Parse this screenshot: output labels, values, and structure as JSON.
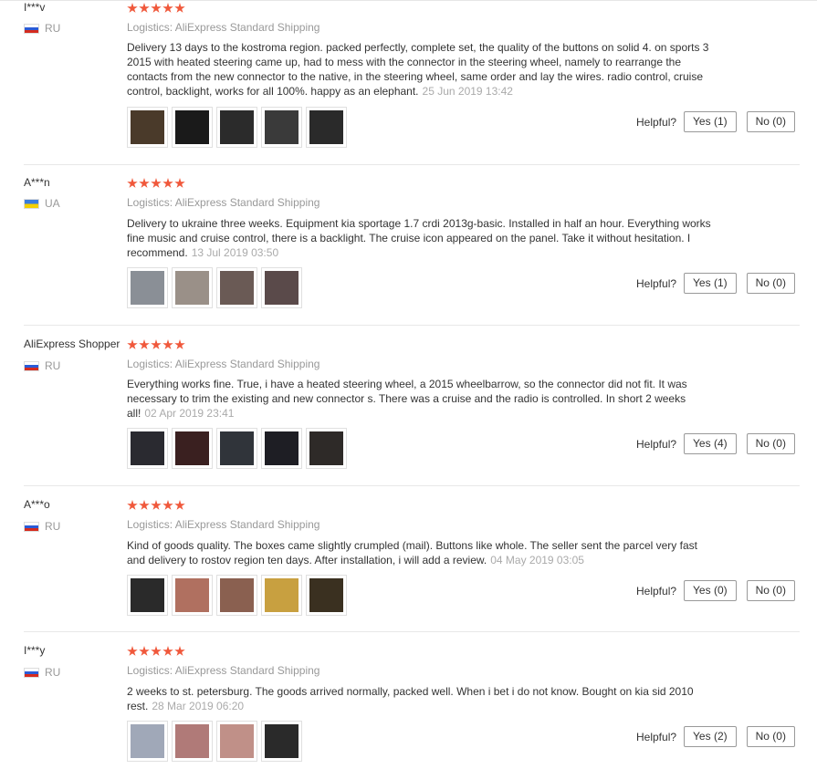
{
  "labels": {
    "helpful": "Helpful?"
  },
  "reviews": [
    {
      "user": "I***v",
      "country": "RU",
      "logistics": "Logistics: AliExpress Standard Shipping",
      "text": "Delivery 13 days to the kostroma region. packed perfectly, complete set, the quality of the buttons on solid 4. on sports 3 2015 with heated steering came up, had to mess with the connector in the steering wheel, namely to rearrange the contacts from the new connector to the native, in the steering wheel, same order and lay the wires. radio control, cruise control, backlight, works for all 100%. happy as an elephant.",
      "date": "25 Jun 2019 13:42",
      "yes": "Yes (1)",
      "no": "No (0)",
      "photo_colors": [
        "#4a3a2a",
        "#1a1a1a",
        "#2b2b2b",
        "#3a3a3a",
        "#2a2a2a"
      ]
    },
    {
      "user": "A***n",
      "country": "UA",
      "logistics": "Logistics: AliExpress Standard Shipping",
      "text": "Delivery to ukraine three weeks. Equipment kia sportage 1.7 crdi 2013g-basic. Installed in half an hour. Everything works fine music and cruise control, there is a backlight. The cruise icon appeared on the panel. Take it without hesitation. I recommend.",
      "date": "13 Jul 2019 03:50",
      "yes": "Yes (1)",
      "no": "No (0)",
      "photo_colors": [
        "#8a8f96",
        "#9a9088",
        "#6a5a55",
        "#5a4a4a"
      ]
    },
    {
      "user": "AliExpress Shopper",
      "country": "RU",
      "logistics": "Logistics: AliExpress Standard Shipping",
      "text": "Everything works fine. True, i have a heated steering wheel, a 2015 wheelbarrow, so the connector did not fit. It was necessary to trim the existing and new connector s. There was a cruise and the radio is controlled. In short 2 weeks all!",
      "date": "02 Apr 2019 23:41",
      "yes": "Yes (4)",
      "no": "No (0)",
      "photo_colors": [
        "#2a2a30",
        "#3a2020",
        "#30343a",
        "#1e1e24",
        "#2e2a28"
      ]
    },
    {
      "user": "A***o",
      "country": "RU",
      "logistics": "Logistics: AliExpress Standard Shipping",
      "text": "Kind of goods quality. The boxes came slightly crumpled (mail). Buttons like whole. The seller sent the parcel very fast and delivery to rostov region ten days. After installation, i will add a review.",
      "date": "04 May 2019 03:05",
      "yes": "Yes (0)",
      "no": "No (0)",
      "photo_colors": [
        "#2a2a2a",
        "#b07060",
        "#8a6050",
        "#c8a040",
        "#3a3020"
      ]
    },
    {
      "user": "I***y",
      "country": "RU",
      "logistics": "Logistics: AliExpress Standard Shipping",
      "text": "2 weeks to st. petersburg. The goods arrived normally, packed well. When i bet i do not know. Bought on kia sid 2010 rest.",
      "date": "28 Mar 2019 06:20",
      "yes": "Yes (2)",
      "no": "No (0)",
      "photo_colors": [
        "#a0a8b8",
        "#b07a78",
        "#c09088",
        "#2a2a2a"
      ]
    }
  ],
  "colors": {
    "star": "#f0583b",
    "meta": "#999999",
    "text": "#333333"
  }
}
